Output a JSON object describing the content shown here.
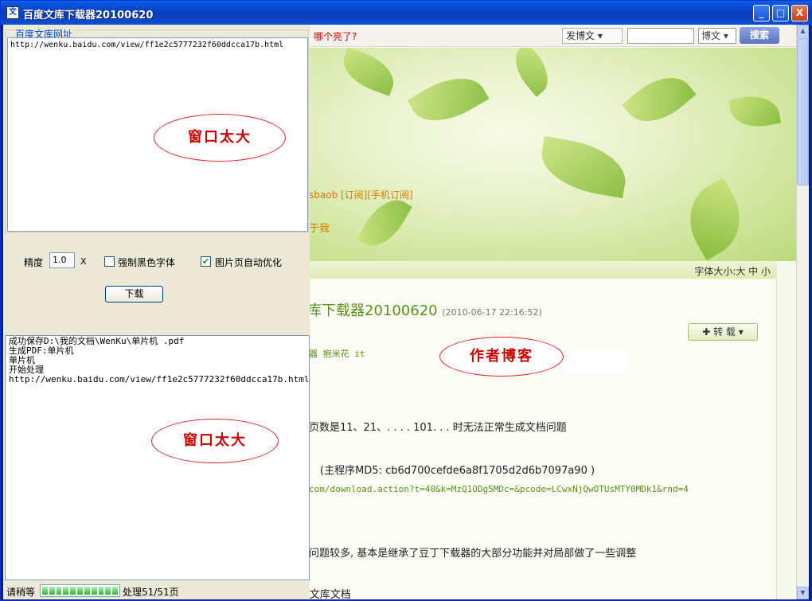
{
  "window": {
    "title": "百度文库下载器20100620",
    "icon_letter": "文",
    "buttons": {
      "minimize": "_",
      "maximize": "□",
      "close": "X"
    }
  },
  "browser": {
    "hot_link": "哪个亮了?",
    "post_button": "发博文 ▾",
    "search_select": "博文 ▾",
    "search_button": "搜索",
    "blog_links": "sbaob [订阅][手机订阅]",
    "blog_about": "于我",
    "font_size_label": "字体大小:大 中 小",
    "post_title": "库下载器20100620",
    "post_date": "(2010-06-17 22:16:52)",
    "reprint_button": "✚ 转 载 ▾",
    "tags": "器 抱米花 it",
    "lines": [
      "页数是11、21、. . . . 101. . . 时无法正常生成文档问题",
      "(主程序MD5: cb6d700cefde6a8f1705d2d6b7097a90  )",
      "com/download.action?t=40&k=MzQ1ODg5MDc=&pcode=LCwxNjQwOTUsMTY0MDk1&rnd=4",
      "问题较多, 基本是继承了豆丁下载器的大部分功能并对局部做了一些调整",
      "::文库文档"
    ]
  },
  "tool": {
    "group_label": "百度文库网址",
    "url_text": "http://wenku.baidu.com/view/ff1e2c5777232f60ddcca17b.html",
    "precision_label": "精度",
    "precision_value": "1.0",
    "precision_unit": "X",
    "force_black_label": "强制黑色字体",
    "force_black_checked": false,
    "auto_optimize_label": "图片页自动优化",
    "auto_optimize_checked": true,
    "download_button": "下载",
    "log_lines": [
      "成功保存D:\\我的文档\\WenKu\\单片机 .pdf",
      "生成PDF:单片机",
      "单片机",
      "开始处理",
      "http://wenku.baidu.com/view/ff1e2c5777232f60ddcca17b.html"
    ],
    "status_text": "请稍等",
    "progress_fraction": 1.0,
    "progress_text": "处理51/51页"
  },
  "annotations": {
    "top_oval": "窗口太大",
    "blog_oval": "作者博客",
    "bottom_oval": "窗口太大"
  }
}
